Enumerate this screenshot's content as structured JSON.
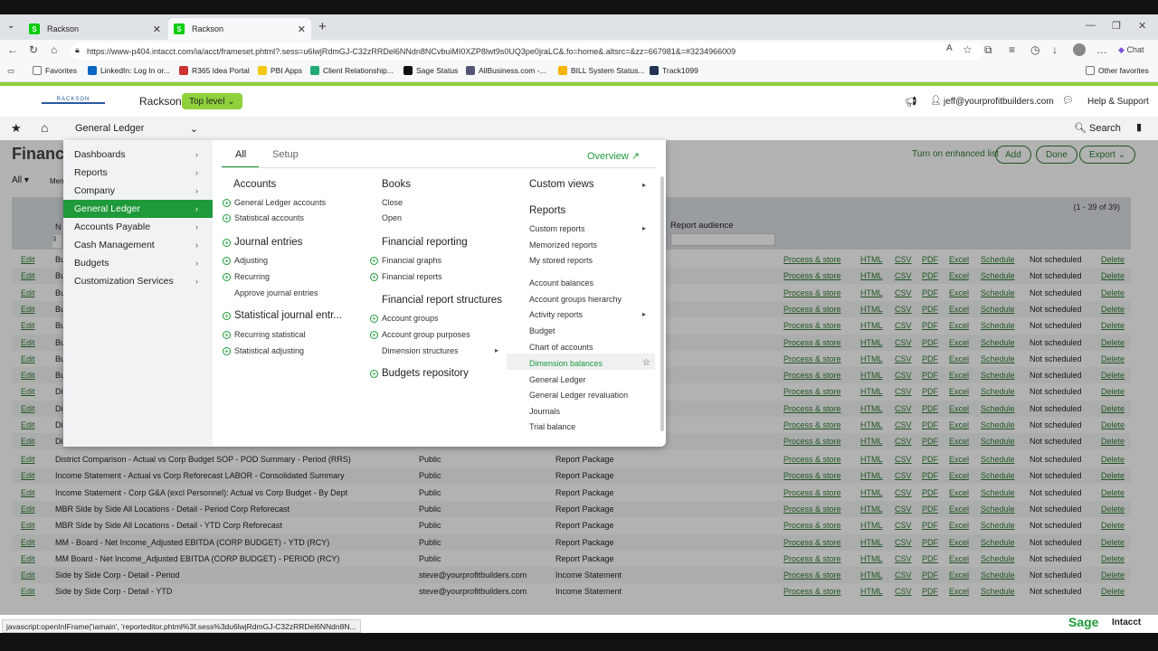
{
  "browser": {
    "tabs": [
      {
        "title": "Rackson"
      },
      {
        "title": "Rackson"
      }
    ],
    "url": "https://www-p404.intacct.com/ia/acct/frameset.phtml?.sess=u6lwjRdmGJ-C32zRRDel6NNdn8NCvbuiMI0XZP8lwt9s0UQ3pe0jraLC&.fo=home&.altsrc=&zz=667981&=#3234966009",
    "favorites": [
      "Favorites",
      "LinkedIn: Log In or...",
      "R365 Idea Portal",
      "PBI Apps",
      "Client Relationship...",
      "Sage Status",
      "AllBusiness.com -...",
      "BILL System Status...",
      "Track1099"
    ],
    "other_favorites": "Other favorites",
    "chat": "Chat"
  },
  "app": {
    "logo_text": "RACKSON",
    "company": "Rackson",
    "level": "Top level",
    "user": "jeff@yourprofitbuilders.com",
    "help": "Help & Support",
    "module": "General Ledger",
    "search": "Search"
  },
  "page": {
    "title": "Financia",
    "filter": "All",
    "mem_truncated": "Mem",
    "enhanced": "Turn on enhanced list",
    "btn_add": "Add",
    "btn_done": "Done",
    "btn_export": "Export",
    "count": "(1 - 39 of 39)",
    "col_n": "N",
    "col_audience": "Report audience",
    "col_9": "9"
  },
  "rows_hidden": [
    {
      "edit": "Edit",
      "name": "Bu"
    },
    {
      "edit": "Edit",
      "name": "Bu"
    },
    {
      "edit": "Edit",
      "name": "Bu"
    },
    {
      "edit": "Edit",
      "name": "Bu"
    },
    {
      "edit": "Edit",
      "name": "Bu"
    },
    {
      "edit": "Edit",
      "name": "Bu"
    },
    {
      "edit": "Edit",
      "name": "Bu"
    },
    {
      "edit": "Edit",
      "name": "Bu"
    },
    {
      "edit": "Edit",
      "name": "Di"
    },
    {
      "edit": "Edit",
      "name": "Di"
    },
    {
      "edit": "Edit",
      "name": "Di"
    },
    {
      "edit": "Edit",
      "name": "Di"
    }
  ],
  "rows": [
    {
      "edit": "Edit",
      "name": "District Comparison - Actual vs Corp Budget SOP - POD Summary - Period (RRS)",
      "owner": "Public",
      "type": "Report Package"
    },
    {
      "edit": "Edit",
      "name": "Income Statement - Actual vs Corp Reforecast LABOR - Consolidated Summary",
      "owner": "Public",
      "type": "Report Package"
    },
    {
      "edit": "Edit",
      "name": "Income Statement - Corp G&A (excl Personnel): Actual vs Corp Budget - By Dept",
      "owner": "Public",
      "type": "Report Package"
    },
    {
      "edit": "Edit",
      "name": "MBR Side by Side All Locations - Detail - Period Corp Reforecast",
      "owner": "Public",
      "type": "Report Package"
    },
    {
      "edit": "Edit",
      "name": "MBR Side by Side All Locations - Detail - YTD Corp Reforecast",
      "owner": "Public",
      "type": "Report Package"
    },
    {
      "edit": "Edit",
      "name": "MM - Board - Net Income_Adjusted EBITDA (CORP BUDGET) - YTD (RCY)",
      "owner": "Public",
      "type": "Report Package"
    },
    {
      "edit": "Edit",
      "name": "MM Board - Net Income_Adjusted EBITDA (CORP BUDGET) - PERIOD (RCY)",
      "owner": "Public",
      "type": "Report Package"
    },
    {
      "edit": "Edit",
      "name": "Side by Side Corp - Detail - Period",
      "owner": "steve@yourprofitbuilders.com",
      "type": "Income Statement"
    },
    {
      "edit": "Edit",
      "name": "Side by Side Corp - Detail - YTD",
      "owner": "steve@yourprofitbuilders.com",
      "type": "Income Statement"
    }
  ],
  "row_actions": {
    "process": "Process & store",
    "html": "HTML",
    "csv": "CSV",
    "pdf": "PDF",
    "excel": "Excel",
    "schedule": "Schedule",
    "status": "Not scheduled",
    "delete": "Delete"
  },
  "menu": {
    "left": [
      "Dashboards",
      "Reports",
      "Company",
      "General Ledger",
      "Accounts Payable",
      "Cash Management",
      "Budgets",
      "Customization Services"
    ],
    "tab_all": "All",
    "tab_setup": "Setup",
    "overview": "Overview",
    "accounts": {
      "head": "Accounts",
      "items": [
        "General Ledger accounts",
        "Statistical accounts"
      ]
    },
    "journal": {
      "head": "Journal entries",
      "items": [
        "Adjusting",
        "Recurring",
        "Approve journal entries"
      ]
    },
    "statj": {
      "head": "Statistical journal entr...",
      "items": [
        "Recurring statistical",
        "Statistical adjusting"
      ]
    },
    "books": {
      "head": "Books",
      "items": [
        "Close",
        "Open"
      ]
    },
    "finrep": {
      "head": "Financial reporting",
      "items": [
        "Financial graphs",
        "Financial reports"
      ]
    },
    "finstruct": {
      "head": "Financial report structures",
      "items": [
        "Account groups",
        "Account group purposes",
        "Dimension structures"
      ]
    },
    "budgets_repo": "Budgets repository",
    "custom_views": "Custom views",
    "reports": {
      "head": "Reports",
      "items": [
        "Custom reports",
        "Memorized reports",
        "My stored reports"
      ]
    },
    "reports2": [
      "Account balances",
      "Account groups hierarchy",
      "Activity reports",
      "Budget",
      "Chart of accounts",
      "Dimension balances",
      "General Ledger",
      "General Ledger revaluation",
      "Journals",
      "Trial balance"
    ]
  },
  "status_url": "javascript:openInIFrame('iamain', 'reporteditor.phtml%3f.sess%3du6lwjRdmGJ-C32zRRDel6NNdn8N...",
  "footer": {
    "sage": "Sage",
    "intacct": "Intacct"
  }
}
